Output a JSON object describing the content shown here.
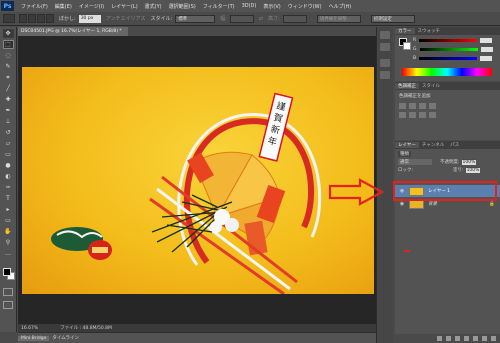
{
  "app": {
    "logo": "Ps"
  },
  "menu": [
    "ファイル(F)",
    "編集(E)",
    "イメージ(I)",
    "レイヤー(L)",
    "書式(Y)",
    "選択範囲(S)",
    "フィルター(T)",
    "3D(D)",
    "表示(V)",
    "ウィンドウ(W)",
    "ヘルプ(H)"
  ],
  "options": {
    "feather_label": "ぼかし:",
    "feather_value": "30 px",
    "antialias_label": "アンチエイリアス",
    "style_label": "スタイル:",
    "style_value": "標準",
    "width_label": "幅:",
    "height_label": "高さ:",
    "refine_label": "境界線を調整...",
    "workspace_value": "初期設定"
  },
  "document": {
    "tab_label": "DSC04501.JPG @ 16.7%(レイヤー 1, RGB/8) *",
    "zoom": "16.67%",
    "file_info": "ファイル : 48.8M/50.8M"
  },
  "bottom_tabs": [
    "Mini Bridge",
    "タイムライン"
  ],
  "color_panel": {
    "tabs": [
      "カラー",
      "スウォッチ"
    ],
    "sliders": [
      {
        "label": "R"
      },
      {
        "label": "G"
      },
      {
        "label": "B"
      }
    ]
  },
  "adjust_panel": {
    "tabs": [
      "色調補正",
      "スタイル"
    ],
    "add_label": "色調補正を追加"
  },
  "layers_panel": {
    "tabs": [
      "レイヤー",
      "チャンネル",
      "パス"
    ],
    "kind_label": "種類",
    "blend_mode": "通常",
    "opacity_label": "不透明度:",
    "opacity_value": "100%",
    "lock_label": "ロック:",
    "fill_label": "塗り:",
    "fill_value": "100%",
    "layers": [
      {
        "name": "レイヤー 1",
        "selected": true
      },
      {
        "name": "背景",
        "selected": false
      }
    ]
  },
  "colors": {
    "highlight": "#e2221b",
    "selected_layer": "#5b80b0"
  }
}
